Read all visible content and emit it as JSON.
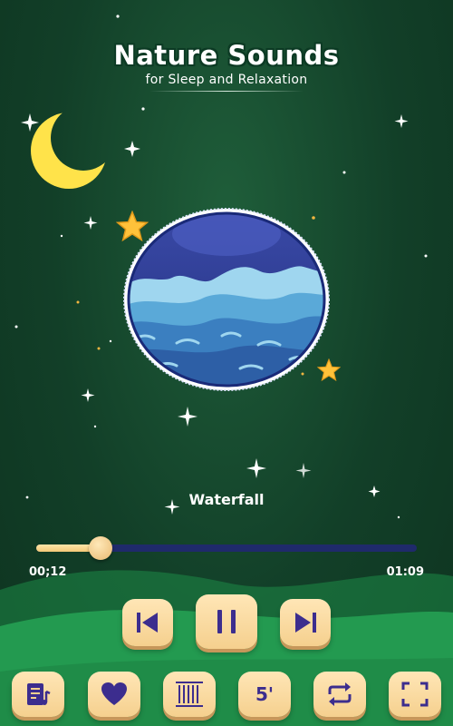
{
  "app": {
    "title": "Nature Sounds",
    "subtitle": "for Sleep and Relaxation"
  },
  "player": {
    "track_name": "Waterfall",
    "elapsed": "00;12",
    "duration": "01:09",
    "progress_fraction": 0.17
  },
  "transport": {
    "previous_icon": "skip-previous-icon",
    "pause_icon": "pause-icon",
    "next_icon": "skip-next-icon"
  },
  "toolbar": {
    "playlist_icon": "playlist-icon",
    "favorite_icon": "heart-icon",
    "sounds_icon": "bars-icon",
    "timer_label": "5'",
    "repeat_icon": "repeat-icon",
    "fullscreen_icon": "fullscreen-icon"
  },
  "colors": {
    "accent_button": "#f5d08e",
    "icon_purple": "#3c2d8e",
    "track_bar": "#1f2a6b",
    "moon": "#ffe34a"
  }
}
